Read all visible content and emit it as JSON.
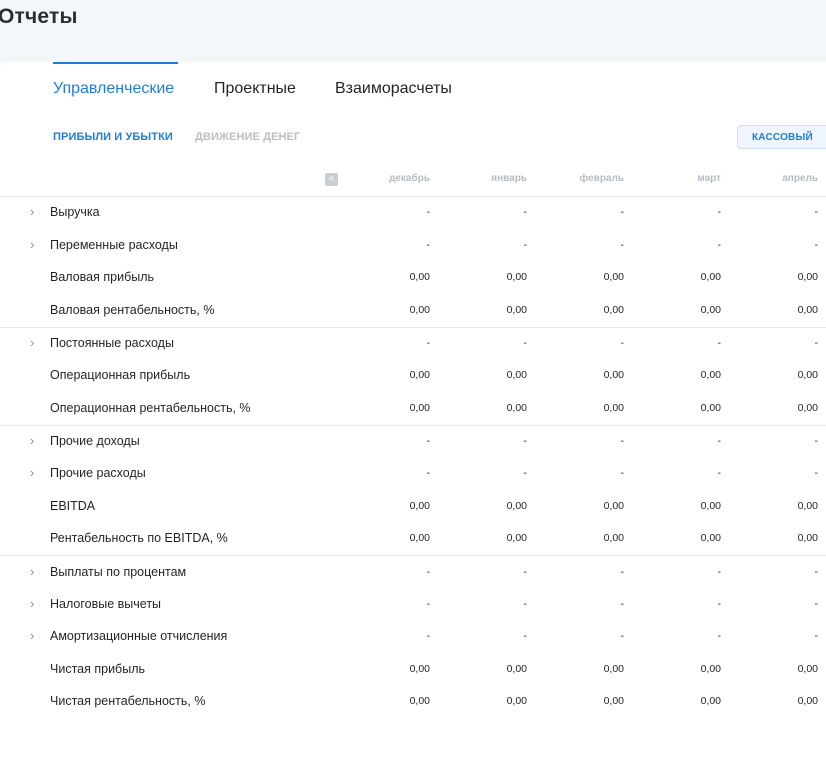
{
  "header": {
    "title": "Отчеты"
  },
  "tabs": [
    {
      "label": "Управленческие",
      "active": true
    },
    {
      "label": "Проектные",
      "active": false
    },
    {
      "label": "Взаиморасчеты",
      "active": false
    }
  ],
  "subtabs": [
    {
      "label": "ПРИБЫЛИ И УБЫТКИ",
      "active": true
    },
    {
      "label": "ДВИЖЕНИЕ ДЕНЕГ",
      "active": false
    }
  ],
  "mode_button": "КАССОВЫЙ",
  "collapse_icon": "«",
  "columns": [
    "декабрь",
    "январь",
    "февраль",
    "март",
    "апрель"
  ],
  "rows": [
    {
      "label": "Выручка",
      "expandable": true,
      "values": [
        "-",
        "-",
        "-",
        "-",
        "-"
      ]
    },
    {
      "label": "Переменные расходы",
      "expandable": true,
      "values": [
        "-",
        "-",
        "-",
        "-",
        "-"
      ]
    },
    {
      "label": "Валовая прибыль",
      "expandable": false,
      "values": [
        "0,00",
        "0,00",
        "0,00",
        "0,00",
        "0,00"
      ]
    },
    {
      "label": "Валовая рентабельность, %",
      "expandable": false,
      "values": [
        "0,00",
        "0,00",
        "0,00",
        "0,00",
        "0,00"
      ]
    },
    {
      "label": "Постоянные расходы",
      "expandable": true,
      "values": [
        "-",
        "-",
        "-",
        "-",
        "-"
      ]
    },
    {
      "label": "Операционная прибыль",
      "expandable": false,
      "values": [
        "0,00",
        "0,00",
        "0,00",
        "0,00",
        "0,00"
      ]
    },
    {
      "label": "Операционная рентабельность, %",
      "expandable": false,
      "values": [
        "0,00",
        "0,00",
        "0,00",
        "0,00",
        "0,00"
      ]
    },
    {
      "label": "Прочие доходы",
      "expandable": true,
      "values": [
        "-",
        "-",
        "-",
        "-",
        "-"
      ]
    },
    {
      "label": "Прочие расходы",
      "expandable": true,
      "values": [
        "-",
        "-",
        "-",
        "-",
        "-"
      ]
    },
    {
      "label": "EBITDA",
      "expandable": false,
      "values": [
        "0,00",
        "0,00",
        "0,00",
        "0,00",
        "0,00"
      ]
    },
    {
      "label": "Рентабельность по EBITDA, %",
      "expandable": false,
      "values": [
        "0,00",
        "0,00",
        "0,00",
        "0,00",
        "0,00"
      ]
    },
    {
      "label": "Выплаты по процентам",
      "expandable": true,
      "values": [
        "-",
        "-",
        "-",
        "-",
        "-"
      ]
    },
    {
      "label": "Налоговые вычеты",
      "expandable": true,
      "values": [
        "-",
        "-",
        "-",
        "-",
        "-"
      ]
    },
    {
      "label": "Амортизационные отчисления",
      "expandable": true,
      "values": [
        "-",
        "-",
        "-",
        "-",
        "-"
      ]
    },
    {
      "label": "Чистая прибыль",
      "expandable": false,
      "values": [
        "0,00",
        "0,00",
        "0,00",
        "0,00",
        "0,00"
      ]
    },
    {
      "label": "Чистая рентабельность, %",
      "expandable": false,
      "values": [
        "0,00",
        "0,00",
        "0,00",
        "0,00",
        "0,00"
      ]
    }
  ]
}
